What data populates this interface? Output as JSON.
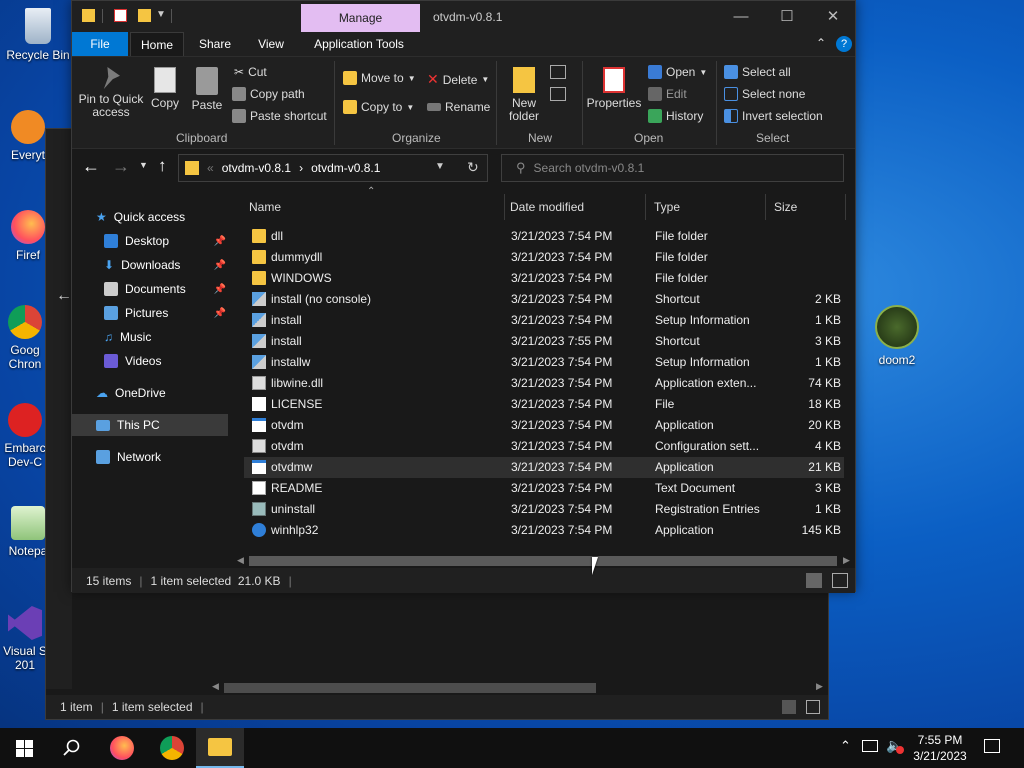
{
  "desktop": {
    "icons": [
      {
        "label": "Recycle Bin",
        "name": "recycle-bin"
      },
      {
        "label": "Everyt",
        "name": "everything"
      },
      {
        "label": "Firef",
        "name": "firefox"
      },
      {
        "label": "Goog Chron",
        "name": "google-chrome"
      },
      {
        "label": "Embarc Dev-C",
        "name": "embarcadero-dev-cpp"
      },
      {
        "label": "Notepa",
        "name": "notepad"
      },
      {
        "label": "Visual S 201",
        "name": "visual-studio"
      },
      {
        "label": "doom2",
        "name": "doom2"
      }
    ]
  },
  "backWindow": {
    "status_count": "1 item",
    "status_selected": "1 item selected"
  },
  "window": {
    "title": "otvdm-v0.8.1",
    "manage_tab": "Manage",
    "tabs": [
      "File",
      "Home",
      "Share",
      "View",
      "Application Tools"
    ],
    "active_tab": "Home"
  },
  "ribbon": {
    "clipboard": {
      "pin": "Pin to Quick access",
      "copy": "Copy",
      "paste": "Paste",
      "cut": "Cut",
      "copy_path": "Copy path",
      "paste_shortcut": "Paste shortcut",
      "label": "Clipboard"
    },
    "organize": {
      "move_to": "Move to",
      "copy_to": "Copy to",
      "delete": "Delete",
      "rename": "Rename",
      "label": "Organize"
    },
    "new": {
      "new_folder": "New folder",
      "label": "New"
    },
    "open": {
      "properties": "Properties",
      "open": "Open",
      "edit": "Edit",
      "history": "History",
      "label": "Open"
    },
    "select": {
      "select_all": "Select all",
      "select_none": "Select none",
      "invert": "Invert selection",
      "label": "Select"
    }
  },
  "address": {
    "crumb1": "otvdm-v0.8.1",
    "crumb2": "otvdm-v0.8.1",
    "search_placeholder": "Search otvdm-v0.8.1"
  },
  "nav": {
    "quick_access": "Quick access",
    "items": [
      "Desktop",
      "Downloads",
      "Documents",
      "Pictures",
      "Music",
      "Videos"
    ],
    "onedrive": "OneDrive",
    "this_pc": "This PC",
    "network": "Network"
  },
  "columns": {
    "name": "Name",
    "date": "Date modified",
    "type": "Type",
    "size": "Size"
  },
  "files": [
    {
      "name": "dll",
      "date": "3/21/2023 7:54 PM",
      "type": "File folder",
      "size": "",
      "icon": "folder"
    },
    {
      "name": "dummydll",
      "date": "3/21/2023 7:54 PM",
      "type": "File folder",
      "size": "",
      "icon": "folder"
    },
    {
      "name": "WINDOWS",
      "date": "3/21/2023 7:54 PM",
      "type": "File folder",
      "size": "",
      "icon": "folder"
    },
    {
      "name": "install (no console)",
      "date": "3/21/2023 7:54 PM",
      "type": "Shortcut",
      "size": "2 KB",
      "icon": "setup"
    },
    {
      "name": "install",
      "date": "3/21/2023 7:54 PM",
      "type": "Setup Information",
      "size": "1 KB",
      "icon": "setup"
    },
    {
      "name": "install",
      "date": "3/21/2023 7:55 PM",
      "type": "Shortcut",
      "size": "3 KB",
      "icon": "setup"
    },
    {
      "name": "installw",
      "date": "3/21/2023 7:54 PM",
      "type": "Setup Information",
      "size": "1 KB",
      "icon": "setup"
    },
    {
      "name": "libwine.dll",
      "date": "3/21/2023 7:54 PM",
      "type": "Application exten...",
      "size": "74 KB",
      "icon": "dll"
    },
    {
      "name": "LICENSE",
      "date": "3/21/2023 7:54 PM",
      "type": "File",
      "size": "18 KB",
      "icon": "file"
    },
    {
      "name": "otvdm",
      "date": "3/21/2023 7:54 PM",
      "type": "Application",
      "size": "20 KB",
      "icon": "app"
    },
    {
      "name": "otvdm",
      "date": "3/21/2023 7:54 PM",
      "type": "Configuration sett...",
      "size": "4 KB",
      "icon": "config"
    },
    {
      "name": "otvdmw",
      "date": "3/21/2023 7:54 PM",
      "type": "Application",
      "size": "21 KB",
      "icon": "app",
      "selected": true
    },
    {
      "name": "README",
      "date": "3/21/2023 7:54 PM",
      "type": "Text Document",
      "size": "3 KB",
      "icon": "text"
    },
    {
      "name": "uninstall",
      "date": "3/21/2023 7:54 PM",
      "type": "Registration Entries",
      "size": "1 KB",
      "icon": "reg"
    },
    {
      "name": "winhlp32",
      "date": "3/21/2023 7:54 PM",
      "type": "Application",
      "size": "145 KB",
      "icon": "help"
    }
  ],
  "status": {
    "count": "15 items",
    "selected": "1 item selected  21.0 KB"
  },
  "taskbar": {
    "time": "7:55 PM",
    "date": "3/21/2023"
  },
  "colors": {
    "accent": "#0078d4",
    "manage_tab": "#e3bdf2",
    "folder": "#f5c542"
  }
}
